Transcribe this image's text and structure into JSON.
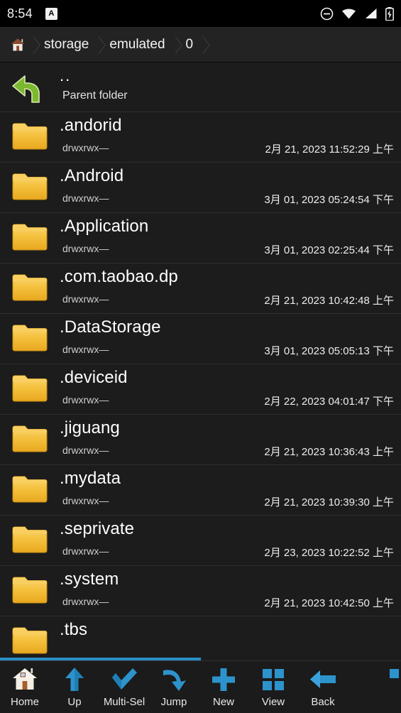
{
  "statusbar": {
    "time": "8:54",
    "ime_label": "A",
    "icons": [
      "do-not-disturb-icon",
      "wifi-icon",
      "cellular-signal-icon",
      "battery-charging-icon"
    ]
  },
  "breadcrumb": {
    "home_icon": "home-icon",
    "items": [
      {
        "label": "storage"
      },
      {
        "label": "emulated"
      },
      {
        "label": "0"
      }
    ]
  },
  "colors": {
    "accent_blue": "#2b8fc4",
    "folder_yellow": "#f5c242",
    "parent_arrow_green": "#7cb82f",
    "background": "#1c1c1c",
    "breadcrumb_bg": "#232323",
    "divider": "#2e2e2e"
  },
  "list": {
    "parent": {
      "name": "..",
      "subtitle": "Parent folder",
      "icon": "back-arrow-icon"
    },
    "permissions_label": "drwxrwx—",
    "entries": [
      {
        "name": ".andorid",
        "permissions": "drwxrwx—",
        "modified": "2月 21, 2023 11:52:29 上午"
      },
      {
        "name": ".Android",
        "permissions": "drwxrwx—",
        "modified": "3月 01, 2023 05:24:54 下午"
      },
      {
        "name": ".Application",
        "permissions": "drwxrwx—",
        "modified": "3月 01, 2023 02:25:44 下午"
      },
      {
        "name": ".com.taobao.dp",
        "permissions": "drwxrwx—",
        "modified": "2月 21, 2023 10:42:48 上午"
      },
      {
        "name": ".DataStorage",
        "permissions": "drwxrwx—",
        "modified": "3月 01, 2023 05:05:13 下午"
      },
      {
        "name": ".deviceid",
        "permissions": "drwxrwx—",
        "modified": "2月 22, 2023 04:01:47 下午"
      },
      {
        "name": ".jiguang",
        "permissions": "drwxrwx—",
        "modified": "2月 21, 2023 10:36:43 上午"
      },
      {
        "name": ".mydata",
        "permissions": "drwxrwx—",
        "modified": "2月 21, 2023 10:39:30 上午"
      },
      {
        "name": ".seprivate",
        "permissions": "drwxrwx—",
        "modified": "2月 23, 2023 10:22:52 上午"
      },
      {
        "name": ".system",
        "permissions": "drwxrwx—",
        "modified": "2月 21, 2023 10:42:50 上午"
      },
      {
        "name": ".tbs",
        "permissions": "",
        "modified": ""
      }
    ],
    "scroll_percent": 50
  },
  "toolbar": {
    "items": [
      {
        "label": "Home",
        "icon": "home-icon"
      },
      {
        "label": "Up",
        "icon": "arrow-up-icon"
      },
      {
        "label": "Multi-Sel",
        "icon": "checkmark-icon"
      },
      {
        "label": "Jump",
        "icon": "curved-arrow-icon"
      },
      {
        "label": "New",
        "icon": "plus-icon"
      },
      {
        "label": "View",
        "icon": "grid-icon"
      },
      {
        "label": "Back",
        "icon": "arrow-left-icon"
      }
    ]
  }
}
